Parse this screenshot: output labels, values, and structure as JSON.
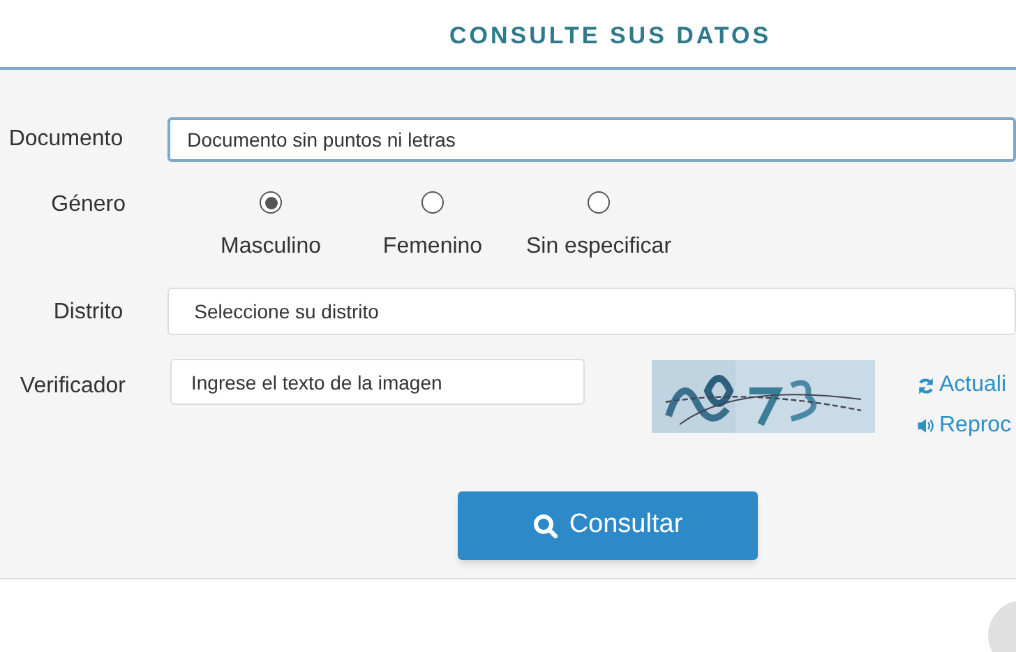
{
  "title": "CONSULTE SUS DATOS",
  "documento": {
    "label": "Documento",
    "placeholder": "Documento sin puntos ni letras",
    "focused": true
  },
  "genero": {
    "label": "Género",
    "options": [
      {
        "label": "Masculino",
        "selected": true
      },
      {
        "label": "Femenino",
        "selected": false
      },
      {
        "label": "Sin especificar",
        "selected": false
      }
    ]
  },
  "distrito": {
    "label": "Distrito",
    "placeholder": "Seleccione su distrito"
  },
  "verificador": {
    "label": "Verificador",
    "placeholder": "Ingrese el texto de la imagen",
    "links": [
      {
        "kind": "refresh",
        "label": "Actuali"
      },
      {
        "kind": "audio",
        "label": "Reproc"
      }
    ]
  },
  "submit": {
    "label": "Consultar"
  }
}
